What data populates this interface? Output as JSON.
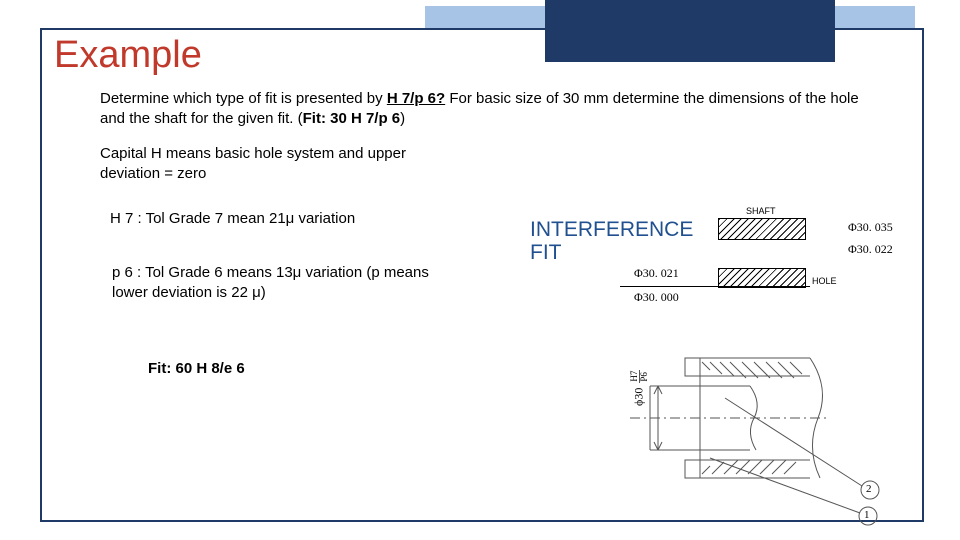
{
  "title": "Example",
  "prompt": {
    "pre": "Determine which type of fit is presented by ",
    "fit_underline": "H 7/p 6?",
    "mid": " For basic size of 30 mm determine the dimensions of the hole and the shaft for the given fit. (",
    "fit_bold": "Fit: 30 H 7/p 6",
    "post": ")"
  },
  "note": "Capital H means basic hole system and upper deviation = zero",
  "bullet1": "H 7  : Tol Grade 7 mean 21μ variation",
  "bullet2": "p 6 : Tol Grade 6 means 13μ variation (p means lower deviation is 22 μ)",
  "bullet3": "Fit: 60 H 8/e 6",
  "interference_heading": "INTERFERENCE FIT",
  "diagram": {
    "shaft_label": "SHAFT",
    "hole_label": "HOLE",
    "dim_shaft_upper": "Φ30. 035",
    "dim_shaft_lower": "Φ30. 022",
    "dim_hole_upper": "Φ30. 021",
    "dim_hole_lower": "Φ30. 000"
  },
  "drawing": {
    "dia_label": "ϕ30",
    "fit_frac_top": "H7",
    "fit_frac_bot": "P6",
    "leader1": "1",
    "leader2": "2"
  }
}
